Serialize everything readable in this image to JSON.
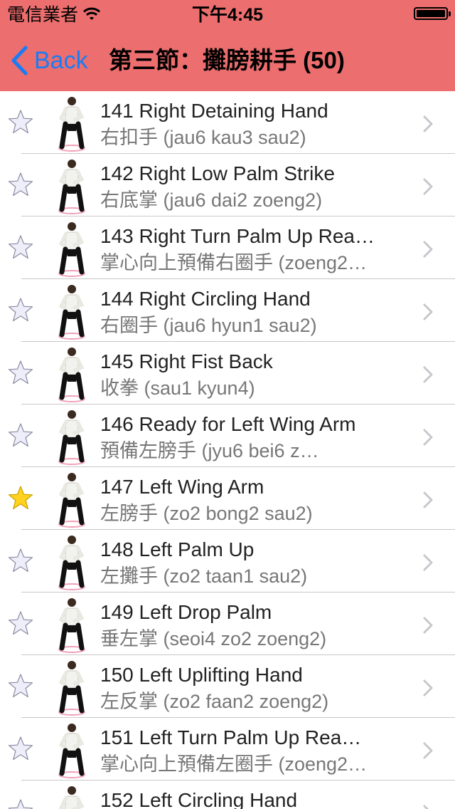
{
  "status_bar": {
    "carrier": "電信業者",
    "time": "下午4:45"
  },
  "nav": {
    "back_label": "Back",
    "title": "第三節：攤膀耕手 (50)"
  },
  "colors": {
    "header": "#ec6e6e",
    "accent": "#1a7cf4",
    "star_on": "#ffd21f",
    "star_off": "#eeeefa"
  },
  "rows": [
    {
      "title": "141 Right Detaining Hand",
      "subtitle": "右扣手 (jau6 kau3 sau2)",
      "starred": false
    },
    {
      "title": "142 Right Low Palm Strike",
      "subtitle": "右底掌 (jau6 dai2 zoeng2)",
      "starred": false
    },
    {
      "title": "143 Right Turn Palm Up Rea…",
      "subtitle": "掌心向上預備右圈手 (zoeng2…",
      "starred": false
    },
    {
      "title": "144 Right Circling Hand",
      "subtitle": "右圈手 (jau6 hyun1 sau2)",
      "starred": false
    },
    {
      "title": "145 Right Fist Back",
      "subtitle": "收拳 (sau1 kyun4)",
      "starred": false
    },
    {
      "title": "146 Ready for Left Wing Arm",
      "subtitle": "預備左膀手 (jyu6 bei6 z…",
      "starred": false
    },
    {
      "title": "147 Left Wing Arm",
      "subtitle": "左膀手 (zo2 bong2 sau2)",
      "starred": true
    },
    {
      "title": "148 Left Palm Up",
      "subtitle": "左攤手 (zo2 taan1 sau2)",
      "starred": false
    },
    {
      "title": "149 Left Drop Palm",
      "subtitle": "垂左掌 (seoi4 zo2 zoeng2)",
      "starred": false
    },
    {
      "title": "150 Left Uplifting Hand",
      "subtitle": "左反掌 (zo2 faan2 zoeng2)",
      "starred": false
    },
    {
      "title": "151 Left Turn Palm Up Rea…",
      "subtitle": "掌心向上預備左圈手 (zoeng2…",
      "starred": false
    },
    {
      "title": "152 Left Circling Hand",
      "subtitle": "",
      "starred": false
    }
  ]
}
